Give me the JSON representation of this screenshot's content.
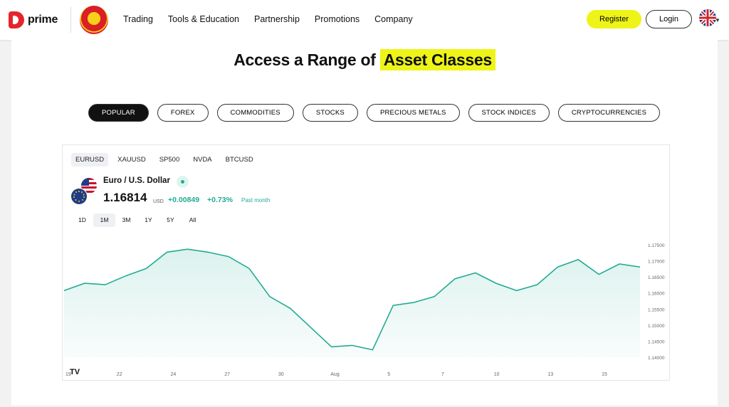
{
  "header": {
    "logo_text": "prime",
    "nav": [
      "Trading",
      "Tools & Education",
      "Partnership",
      "Promotions",
      "Company"
    ],
    "register_label": "Register",
    "login_label": "Login"
  },
  "hero": {
    "title_prefix": "Access a Range of",
    "title_highlight": "Asset Classes"
  },
  "asset_tabs": [
    "POPULAR",
    "FOREX",
    "COMMODITIES",
    "STOCKS",
    "PRECIOUS METALS",
    "STOCK INDICES",
    "CRYPTOCURRENCIES"
  ],
  "asset_tab_active": "POPULAR",
  "widget": {
    "symbols": [
      "EURUSD",
      "XAUUSD",
      "SP500",
      "NVDA",
      "BTCUSD"
    ],
    "symbol_active": "EURUSD",
    "pair_name": "Euro / U.S. Dollar",
    "price": "1.16814",
    "currency": "USD",
    "change": "+0.00849",
    "change_pct": "+0.73%",
    "period_label": "Past month",
    "ranges": [
      "1D",
      "1M",
      "3M",
      "1Y",
      "5Y",
      "All"
    ],
    "range_active": "1M"
  },
  "colors": {
    "accent": "#eef417",
    "positive": "#22ab94",
    "brand_red": "#e3262b"
  },
  "chart_data": {
    "type": "area",
    "x_tick_labels": [
      "19",
      "22",
      "24",
      "27",
      "30",
      "Aug",
      "5",
      "7",
      "10",
      "13",
      "15"
    ],
    "y_tick_labels": [
      "1.17500",
      "1.17000",
      "1.16500",
      "1.16000",
      "1.15500",
      "1.15000",
      "1.14500",
      "1.14000"
    ],
    "ylim": [
      1.139,
      1.177
    ],
    "x": [
      "19",
      "20",
      "21",
      "22",
      "23",
      "24",
      "25",
      "26",
      "27",
      "28",
      "29",
      "30",
      "31",
      "Aug",
      "4",
      "5",
      "6",
      "7",
      "8",
      "9",
      "10",
      "11",
      "12",
      "13",
      "14",
      "15",
      "16",
      "17",
      "18"
    ],
    "values": [
      1.1615,
      1.164,
      1.1635,
      1.1665,
      1.169,
      1.1745,
      1.1755,
      1.1745,
      1.173,
      1.169,
      1.1595,
      1.1555,
      1.149,
      1.1425,
      1.143,
      1.1415,
      1.1565,
      1.1575,
      1.1595,
      1.1655,
      1.1675,
      1.164,
      1.1615,
      1.1635,
      1.1695,
      1.172,
      1.167,
      1.1705,
      1.1695
    ],
    "grid": false,
    "watermark_label": "TV"
  }
}
